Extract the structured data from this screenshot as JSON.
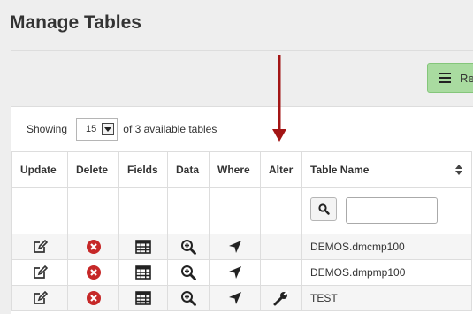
{
  "page": {
    "title": "Manage Tables"
  },
  "report_button": {
    "label": "Re",
    "icon": "menu-bars-icon",
    "color": "#a9dba0"
  },
  "showing": {
    "prefix": "Showing",
    "page_size": "15",
    "suffix": "of 3 available tables"
  },
  "table": {
    "columns": [
      "Update",
      "Delete",
      "Fields",
      "Data",
      "Where",
      "Alter",
      "Table Name"
    ],
    "search": {
      "value": "",
      "placeholder": ""
    },
    "rows": [
      {
        "name": "DEMOS.dmcmp100",
        "alter": false
      },
      {
        "name": "DEMOS.dmpmp100",
        "alter": false
      },
      {
        "name": "TEST",
        "alter": true
      }
    ]
  },
  "colors": {
    "delete": "#c62828",
    "arrow": "#a31515"
  }
}
